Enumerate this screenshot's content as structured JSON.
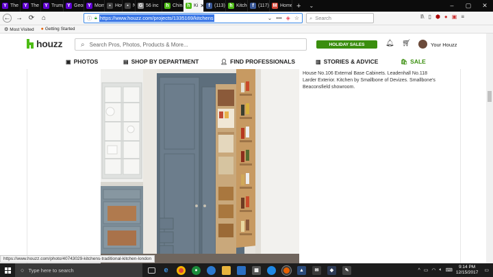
{
  "browser": {
    "tabs": [
      {
        "label": "The Bi",
        "icon": "yahoo-icon",
        "color": "#5f01d1",
        "glyph": "Y"
      },
      {
        "label": "The St",
        "icon": "yahoo-icon",
        "color": "#5f01d1",
        "glyph": "Y"
      },
      {
        "label": "Trump",
        "icon": "yahoo-icon",
        "color": "#5f01d1",
        "glyph": "Y"
      },
      {
        "label": "Georg",
        "icon": "yahoo-icon",
        "color": "#5f01d1",
        "glyph": "Y"
      },
      {
        "label": "Mome",
        "icon": "yahoo-icon",
        "color": "#5f01d1",
        "glyph": "Y"
      },
      {
        "label": "How",
        "icon": "page-icon",
        "color": "#444444",
        "glyph": "▪"
      },
      {
        "label": "Ne",
        "icon": "page-icon",
        "color": "#444444",
        "glyph": "▪"
      },
      {
        "label": "56 inc",
        "icon": "google-icon",
        "color": "#888888",
        "glyph": "G"
      },
      {
        "label": "China",
        "icon": "houzz-icon",
        "color": "#4dbc15",
        "glyph": "h"
      },
      {
        "label": "Ki",
        "icon": "houzz-icon",
        "color": "#4dbc15",
        "glyph": "h",
        "active": true
      },
      {
        "label": "(113)",
        "icon": "facebook-icon",
        "color": "#3b5998",
        "glyph": "f"
      },
      {
        "label": "Kitche",
        "icon": "houzz-icon",
        "color": "#4dbc15",
        "glyph": "h"
      },
      {
        "label": "(117)",
        "icon": "facebook-icon",
        "color": "#3b5998",
        "glyph": "f"
      },
      {
        "label": "Home",
        "icon": "gmail-icon",
        "color": "#d44638",
        "glyph": "M"
      }
    ],
    "url": "https://www.houzz.com/projects/1335169/kitchens",
    "search_placeholder": "Search",
    "bookmarks": [
      {
        "label": "Most Visited",
        "icon": "gear-icon"
      },
      {
        "label": "Getting Started",
        "icon": "firefox-icon"
      }
    ]
  },
  "houzz": {
    "logo": "houzz",
    "search_placeholder": "Search Pros, Photos, Products & More...",
    "holiday_label": "HOLIDAY SALES",
    "user_label": "Your Houzz",
    "nav": [
      {
        "label": "PHOTOS",
        "icon": "photos-icon"
      },
      {
        "label": "SHOP BY DEPARTMENT",
        "icon": "shop-icon"
      },
      {
        "label": "FIND PROFESSIONALS",
        "icon": "pro-icon"
      },
      {
        "label": "STORIES & ADVICE",
        "icon": "stories-icon"
      },
      {
        "label": "SALE",
        "icon": "sale-icon"
      }
    ],
    "caption": "House No.106 External Base Cabinets. Leadenhall No.118 Larder Exterior. Kitchen by Smallbone of Devizes. Smallbone's Beaconsfield showroom."
  },
  "status_url": "https://www.houzz.com/photo/40743029-kitchens-traditional-kitchen-london",
  "taskbar": {
    "search_placeholder": "Type here to search",
    "time": "9:14 PM",
    "date": "12/15/2017"
  },
  "colors": {
    "houzz_green": "#4dbc15",
    "sale_green": "#3a8e0e",
    "cabinet_blue": "#6c7d8c"
  }
}
